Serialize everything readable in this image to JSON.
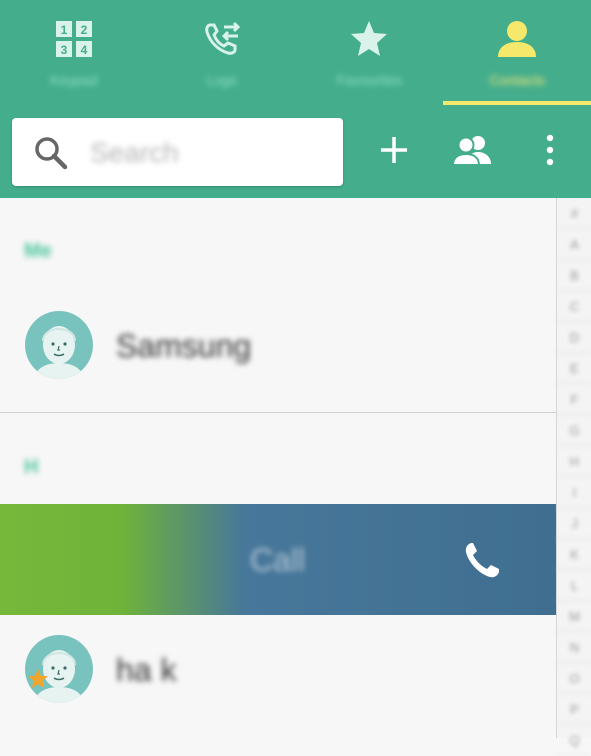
{
  "tabs": [
    {
      "label": "Keypad",
      "icon": "keypad-icon",
      "active": false
    },
    {
      "label": "Logs",
      "icon": "call-log-icon",
      "active": false
    },
    {
      "label": "Favourites",
      "icon": "star-icon",
      "active": false
    },
    {
      "label": "Contacts",
      "icon": "person-icon",
      "active": true
    }
  ],
  "search": {
    "placeholder": "Search"
  },
  "toolbar": {
    "add_icon": "plus-icon",
    "groups_icon": "groups-icon",
    "more_icon": "more-vertical-icon"
  },
  "sections": [
    {
      "header": "Me",
      "contacts": [
        {
          "name": "Samsung",
          "favourite": false
        }
      ]
    },
    {
      "header": "H",
      "contacts": [
        {
          "name": "ha k",
          "favourite": true
        }
      ]
    }
  ],
  "swipe_action": {
    "label": "Call",
    "icon": "phone-icon"
  },
  "index_letters": [
    "#",
    "A",
    "B",
    "C",
    "D",
    "E",
    "F",
    "G",
    "H",
    "I",
    "J",
    "K",
    "L",
    "M",
    "N",
    "O",
    "P",
    "Q"
  ],
  "colors": {
    "header": "#44ae8c",
    "active_tab": "#f5e86a",
    "call_swipe_start": "#76b83a",
    "call_swipe_end": "#3f6e90"
  }
}
